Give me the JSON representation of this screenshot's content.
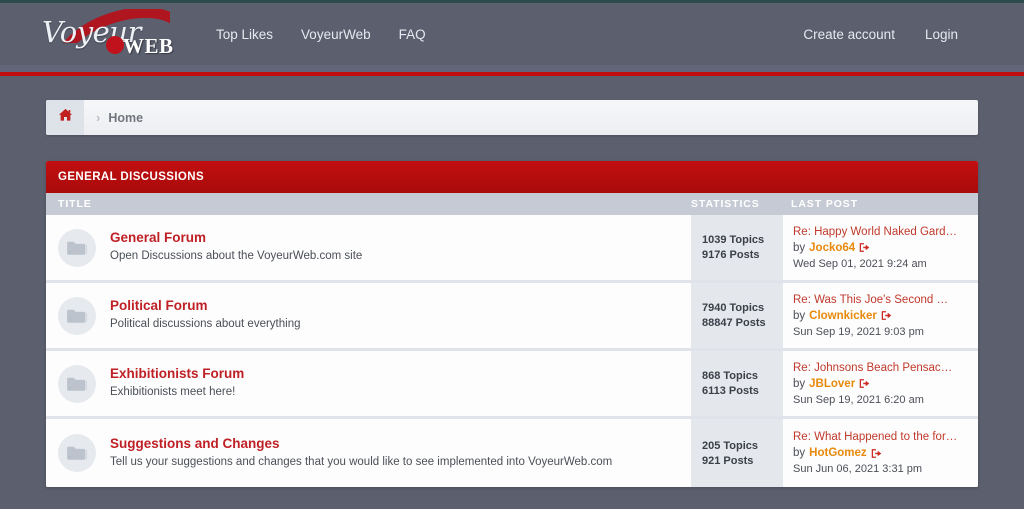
{
  "brand": {
    "logo_script": "Voyeur",
    "logo_web": "WEB",
    "accent_red": "#c20f10",
    "accent_orange": "#e8890c",
    "link_red": "#bf2026",
    "header_bg": "#5b5f6e"
  },
  "nav": {
    "left_links": [
      {
        "label": "Top Likes",
        "name": "nav-link-top-likes"
      },
      {
        "label": "VoyeurWeb",
        "name": "nav-link-voyeurweb"
      },
      {
        "label": "FAQ",
        "name": "nav-link-faq"
      }
    ],
    "right_links": [
      {
        "label": "Create account",
        "name": "nav-link-create-account"
      },
      {
        "label": "Login",
        "name": "nav-link-login"
      }
    ]
  },
  "breadcrumb": {
    "home_icon": "home-icon",
    "separator": "›",
    "items": [
      {
        "label": "Home"
      }
    ]
  },
  "forum": {
    "category_title": "GENERAL DISCUSSIONS",
    "columns": {
      "title": "TITLE",
      "statistics": "STATISTICS",
      "last_post": "LAST POST"
    },
    "by_prefix": "by",
    "goto_icon": "goto-post-icon",
    "folder_icon": "folder-icon",
    "rows": [
      {
        "name": "General Forum",
        "description": "Open Discussions about the VoyeurWeb.com site",
        "topics": "1039 Topics",
        "posts": "9176 Posts",
        "last_subject": "Re: Happy World Naked Gard…",
        "last_user": "Jocko64",
        "last_date": "Wed Sep 01, 2021 9:24 am"
      },
      {
        "name": "Political Forum",
        "description": "Political discussions about everything",
        "topics": "7940 Topics",
        "posts": "88847 Posts",
        "last_subject": "Re: Was This Joe's Second W…",
        "last_user": "Clownkicker",
        "last_date": "Sun Sep 19, 2021 9:03 pm"
      },
      {
        "name": "Exhibitionists Forum",
        "description": "Exhibitionists meet here!",
        "topics": "868 Topics",
        "posts": "6113 Posts",
        "last_subject": "Re: Johnsons Beach Pensacol…",
        "last_user": "JBLover",
        "last_date": "Sun Sep 19, 2021 6:20 am"
      },
      {
        "name": "Suggestions and Changes",
        "description": "Tell us your suggestions and changes that you would like to see implemented into VoyeurWeb.com",
        "topics": "205 Topics",
        "posts": "921 Posts",
        "last_subject": "Re: What Happened to the for…",
        "last_user": "HotGomez",
        "last_date": "Sun Jun 06, 2021 3:31 pm"
      }
    ]
  }
}
